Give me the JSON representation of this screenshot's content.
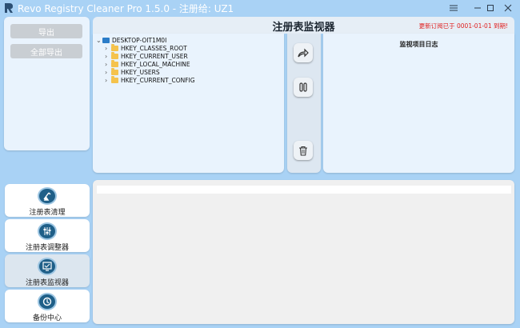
{
  "window": {
    "title": "Revo Registry Cleaner Pro 1.5.0 - 注册给: UZ1",
    "controls": [
      "hamburger-menu",
      "minimize",
      "maximize",
      "close"
    ]
  },
  "left_panel": {
    "export_label": "导出",
    "export_all_label": "全部导出"
  },
  "nav": [
    {
      "label": "注册表清理",
      "icon": "broom-icon"
    },
    {
      "label": "注册表调整器",
      "icon": "sliders-icon"
    },
    {
      "label": "注册表监视器",
      "icon": "monitor-icon",
      "active": true
    },
    {
      "label": "备份中心",
      "icon": "backup-icon"
    }
  ],
  "header": {
    "title": "注册表监视器",
    "notice": "更新订阅已于 0001-01-01 到期!"
  },
  "tree": {
    "root": "DESKTOP-OIT1M0I",
    "children": [
      "HKEY_CLASSES_ROOT",
      "HKEY_CURRENT_USER",
      "HKEY_LOCAL_MACHINE",
      "HKEY_USERS",
      "HKEY_CURRENT_CONFIG"
    ]
  },
  "toolbar": {
    "buttons": [
      "share-arrow-icon",
      "pause-icon",
      "trash-icon"
    ]
  },
  "log_panel": {
    "title": "监视项目日志"
  },
  "colors": {
    "background": "#a9d2f5",
    "panel": "#e9f3fd",
    "notice": "#e02020",
    "nav_icon": "#1f5f88"
  }
}
